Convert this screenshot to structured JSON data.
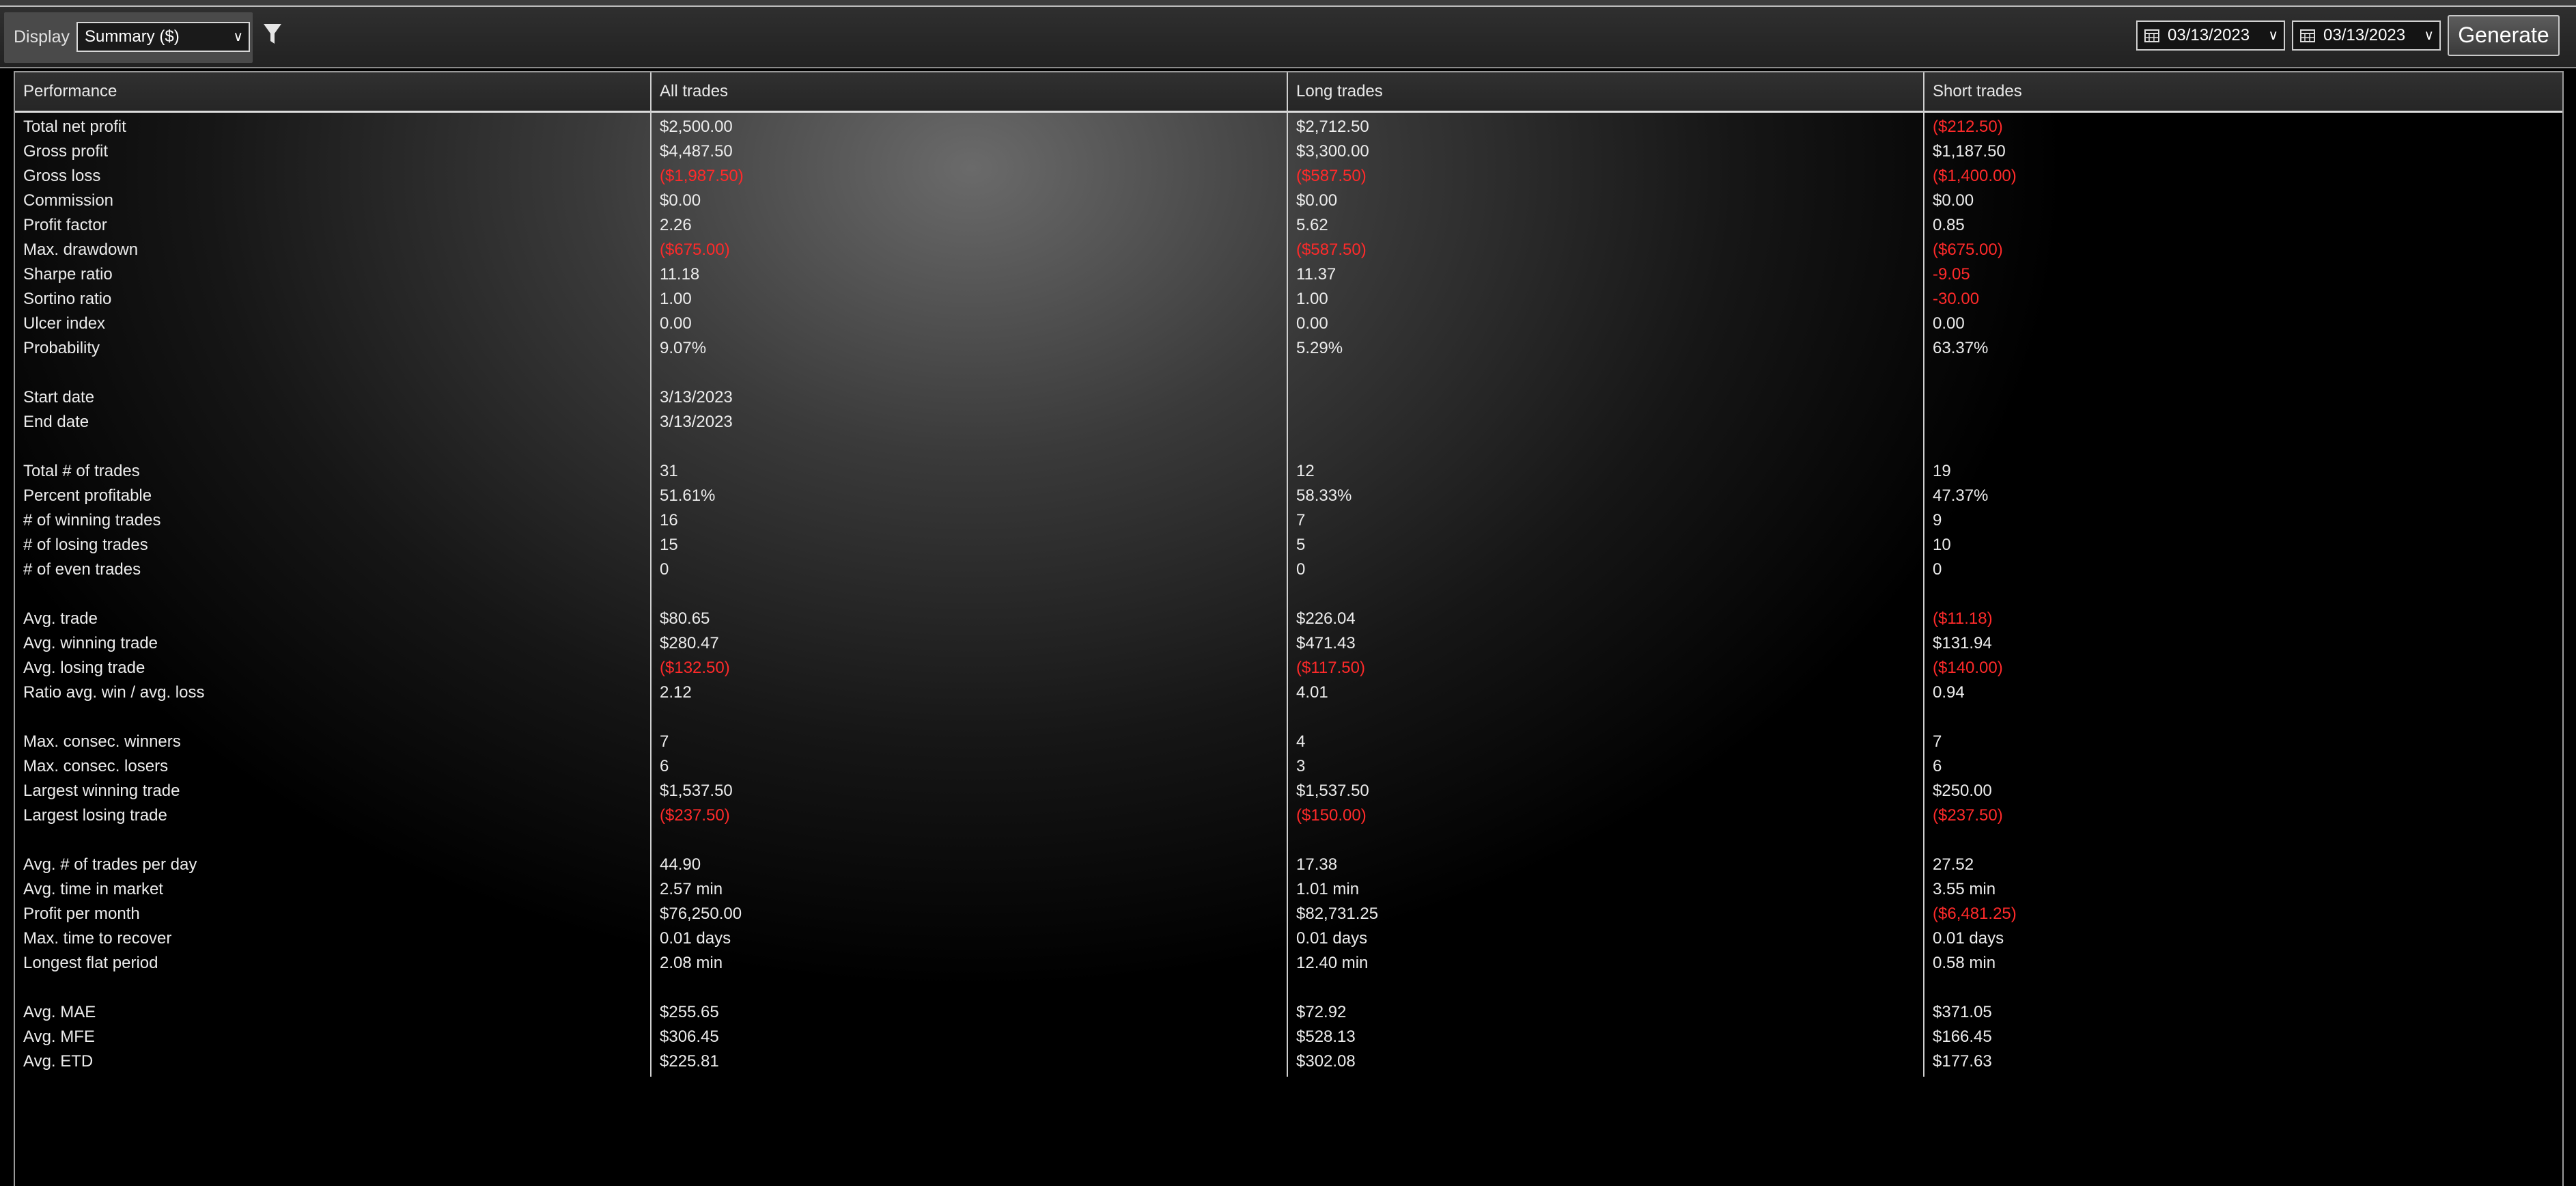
{
  "toolbar": {
    "display_label": "Display",
    "display_value": "Summary ($)",
    "from_date": "03/13/2023",
    "to_date": "03/13/2023",
    "generate_label": "Generate"
  },
  "columns": [
    "Performance",
    "All trades",
    "Long trades",
    "Short trades"
  ],
  "rows": [
    {
      "label": "Total net profit",
      "all": "$2,500.00",
      "long": "$2,712.50",
      "short": "($212.50)"
    },
    {
      "label": "Gross profit",
      "all": "$4,487.50",
      "long": "$3,300.00",
      "short": "$1,187.50"
    },
    {
      "label": "Gross loss",
      "all": "($1,987.50)",
      "long": "($587.50)",
      "short": "($1,400.00)"
    },
    {
      "label": "Commission",
      "all": "$0.00",
      "long": "$0.00",
      "short": "$0.00"
    },
    {
      "label": "Profit factor",
      "all": "2.26",
      "long": "5.62",
      "short": "0.85"
    },
    {
      "label": "Max. drawdown",
      "all": "($675.00)",
      "long": "($587.50)",
      "short": "($675.00)"
    },
    {
      "label": "Sharpe ratio",
      "all": "11.18",
      "long": "11.37",
      "short": "-9.05"
    },
    {
      "label": "Sortino ratio",
      "all": "1.00",
      "long": "1.00",
      "short": "-30.00"
    },
    {
      "label": "Ulcer index",
      "all": "0.00",
      "long": "0.00",
      "short": "0.00"
    },
    {
      "label": "Probability",
      "all": "9.07%",
      "long": "5.29%",
      "short": "63.37%"
    },
    {
      "label": "",
      "all": "",
      "long": "",
      "short": ""
    },
    {
      "label": "Start date",
      "all": "3/13/2023",
      "long": "",
      "short": ""
    },
    {
      "label": "End date",
      "all": "3/13/2023",
      "long": "",
      "short": ""
    },
    {
      "label": "",
      "all": "",
      "long": "",
      "short": ""
    },
    {
      "label": "Total # of trades",
      "all": "31",
      "long": "12",
      "short": "19"
    },
    {
      "label": "Percent profitable",
      "all": "51.61%",
      "long": "58.33%",
      "short": "47.37%"
    },
    {
      "label": "# of winning trades",
      "all": "16",
      "long": "7",
      "short": "9"
    },
    {
      "label": "# of losing trades",
      "all": "15",
      "long": "5",
      "short": "10"
    },
    {
      "label": "# of even trades",
      "all": "0",
      "long": "0",
      "short": "0"
    },
    {
      "label": "",
      "all": "",
      "long": "",
      "short": ""
    },
    {
      "label": "Avg. trade",
      "all": "$80.65",
      "long": "$226.04",
      "short": "($11.18)"
    },
    {
      "label": "Avg. winning trade",
      "all": "$280.47",
      "long": "$471.43",
      "short": "$131.94"
    },
    {
      "label": "Avg. losing trade",
      "all": "($132.50)",
      "long": "($117.50)",
      "short": "($140.00)"
    },
    {
      "label": "Ratio avg. win / avg. loss",
      "all": "2.12",
      "long": "4.01",
      "short": "0.94"
    },
    {
      "label": "",
      "all": "",
      "long": "",
      "short": ""
    },
    {
      "label": "Max. consec. winners",
      "all": "7",
      "long": "4",
      "short": "7"
    },
    {
      "label": "Max. consec. losers",
      "all": "6",
      "long": "3",
      "short": "6"
    },
    {
      "label": "Largest winning trade",
      "all": "$1,537.50",
      "long": "$1,537.50",
      "short": "$250.00"
    },
    {
      "label": "Largest losing trade",
      "all": "($237.50)",
      "long": "($150.00)",
      "short": "($237.50)"
    },
    {
      "label": "",
      "all": "",
      "long": "",
      "short": ""
    },
    {
      "label": "Avg. # of trades per day",
      "all": "44.90",
      "long": "17.38",
      "short": "27.52"
    },
    {
      "label": "Avg. time in market",
      "all": "2.57 min",
      "long": "1.01 min",
      "short": "3.55 min"
    },
    {
      "label": "Profit per month",
      "all": "$76,250.00",
      "long": "$82,731.25",
      "short": "($6,481.25)"
    },
    {
      "label": "Max. time to recover",
      "all": "0.01 days",
      "long": "0.01 days",
      "short": "0.01 days"
    },
    {
      "label": "Longest flat period",
      "all": "2.08 min",
      "long": "12.40 min",
      "short": "0.58 min"
    },
    {
      "label": "",
      "all": "",
      "long": "",
      "short": ""
    },
    {
      "label": "Avg. MAE",
      "all": "$255.65",
      "long": "$72.92",
      "short": "$371.05"
    },
    {
      "label": "Avg. MFE",
      "all": "$306.45",
      "long": "$528.13",
      "short": "$166.45"
    },
    {
      "label": "Avg. ETD",
      "all": "$225.81",
      "long": "$302.08",
      "short": "$177.63"
    }
  ],
  "colors": {
    "negative": "#ff2a2a",
    "text": "#ececec",
    "background": "#000000"
  }
}
